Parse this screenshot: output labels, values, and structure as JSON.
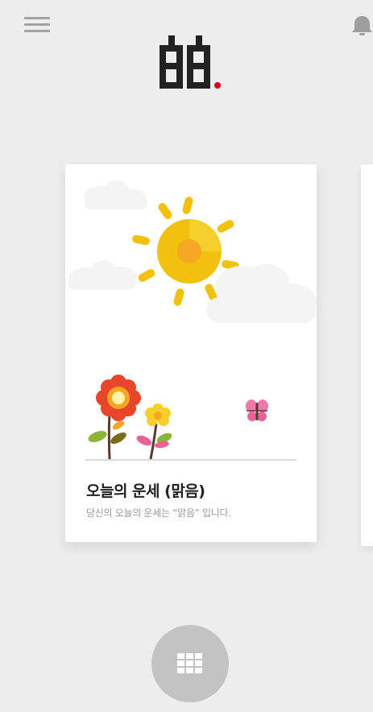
{
  "header": {
    "menu_icon": "hamburger-menu-icon",
    "logo_icon": "app-logo-icon",
    "logo_accent_color": "#d0021b",
    "notification_icon": "bell-icon"
  },
  "card": {
    "illustration_icon": "sunny-weather-illustration",
    "title": "오늘의 운세 (맑음)",
    "description": "당신의 오늘의 운세는 “맑음” 입니다."
  },
  "fab": {
    "icon": "grid-menu-icon"
  }
}
